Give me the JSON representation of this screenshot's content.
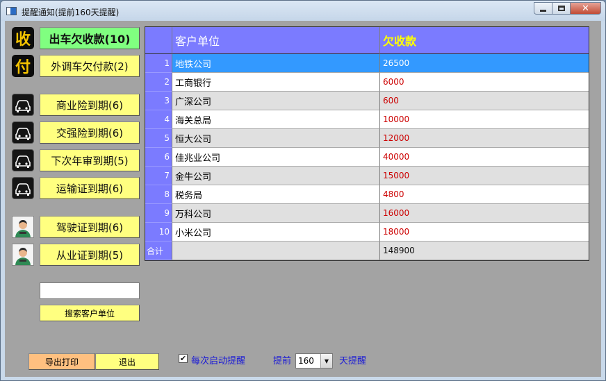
{
  "window": {
    "title": "提醒通知(提前160天提醒)"
  },
  "sidebar": {
    "badge_receive": "收",
    "badge_pay": "付",
    "buttons": [
      {
        "label": "出车欠收款(10)"
      },
      {
        "label": "外调车欠付款(2)"
      },
      {
        "label": "商业险到期(6)"
      },
      {
        "label": "交强险到期(6)"
      },
      {
        "label": "下次年审到期(5)"
      },
      {
        "label": "运输证到期(6)"
      },
      {
        "label": "驾驶证到期(6)"
      },
      {
        "label": "从业证到期(5)"
      }
    ],
    "search_value": "",
    "search_button": "搜索客户单位"
  },
  "grid": {
    "headers": [
      "",
      "客户单位",
      "欠收款"
    ],
    "rows": [
      {
        "no": "1",
        "unit": "地铁公司",
        "amount": "26500"
      },
      {
        "no": "2",
        "unit": "工商银行",
        "amount": "6000"
      },
      {
        "no": "3",
        "unit": "广深公司",
        "amount": "600"
      },
      {
        "no": "4",
        "unit": "海关总局",
        "amount": "10000"
      },
      {
        "no": "5",
        "unit": "恒大公司",
        "amount": "12000"
      },
      {
        "no": "6",
        "unit": "佳兆业公司",
        "amount": "40000"
      },
      {
        "no": "7",
        "unit": "金牛公司",
        "amount": "15000"
      },
      {
        "no": "8",
        "unit": "税务局",
        "amount": "4800"
      },
      {
        "no": "9",
        "unit": "万科公司",
        "amount": "16000"
      },
      {
        "no": "10",
        "unit": "小米公司",
        "amount": "18000"
      }
    ],
    "total_label": "合计",
    "total_unit": "",
    "total_amount": "148900"
  },
  "footer": {
    "export_label": "导出打印",
    "exit_label": "退出",
    "checkbox_checked": true,
    "checkbox_mark": "✔",
    "checkbox_label": "每次启动提醒",
    "ahead_label": "提前",
    "days_value": "160",
    "days_suffix": "天提醒"
  },
  "colors": {
    "header_bg": "#7b7bff",
    "header_amount": "#ffff00",
    "amount_text": "#cc0000",
    "selected_row": "#3399ff",
    "button_yellow": "#ffff80",
    "button_green": "#80ff80",
    "button_orange": "#ffc080"
  }
}
